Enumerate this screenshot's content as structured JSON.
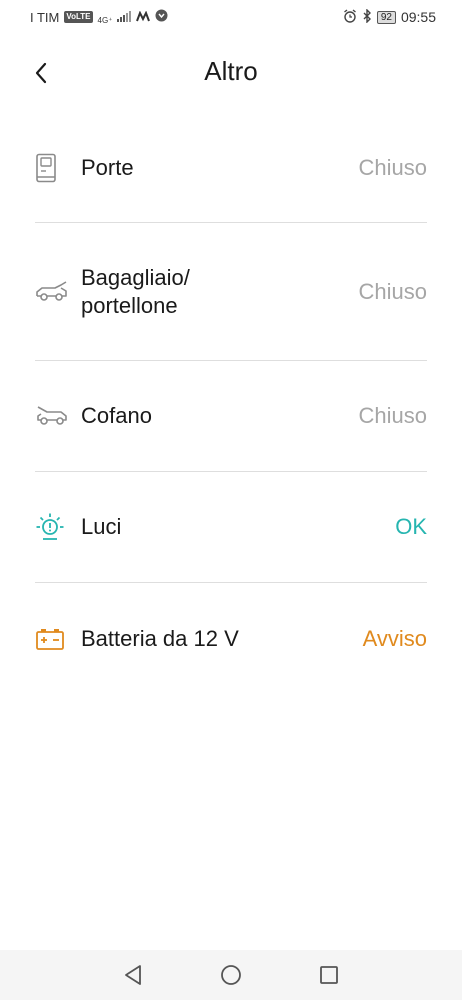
{
  "status_bar": {
    "carrier": "I TIM",
    "volte": "VoLTE",
    "network": "4G⁺",
    "battery": "92",
    "time": "09:55"
  },
  "header": {
    "title": "Altro"
  },
  "items": [
    {
      "label": "Porte",
      "value": "Chiuso",
      "icon": "door-icon",
      "status": "neutral"
    },
    {
      "label": "Bagagliaio/\nportellone",
      "value": "Chiuso",
      "icon": "trunk-icon",
      "status": "neutral"
    },
    {
      "label": "Cofano",
      "value": "Chiuso",
      "icon": "hood-icon",
      "status": "neutral"
    },
    {
      "label": "Luci",
      "value": "OK",
      "icon": "lights-icon",
      "status": "ok"
    },
    {
      "label": "Batteria da 12 V",
      "value": "Avviso",
      "icon": "battery-icon",
      "status": "warning"
    }
  ],
  "colors": {
    "neutral": "#a6a6a6",
    "ok": "#26b5b0",
    "warning": "#e08a1e"
  },
  "nav": [
    "back-nav-icon",
    "home-nav-icon",
    "recents-nav-icon"
  ]
}
